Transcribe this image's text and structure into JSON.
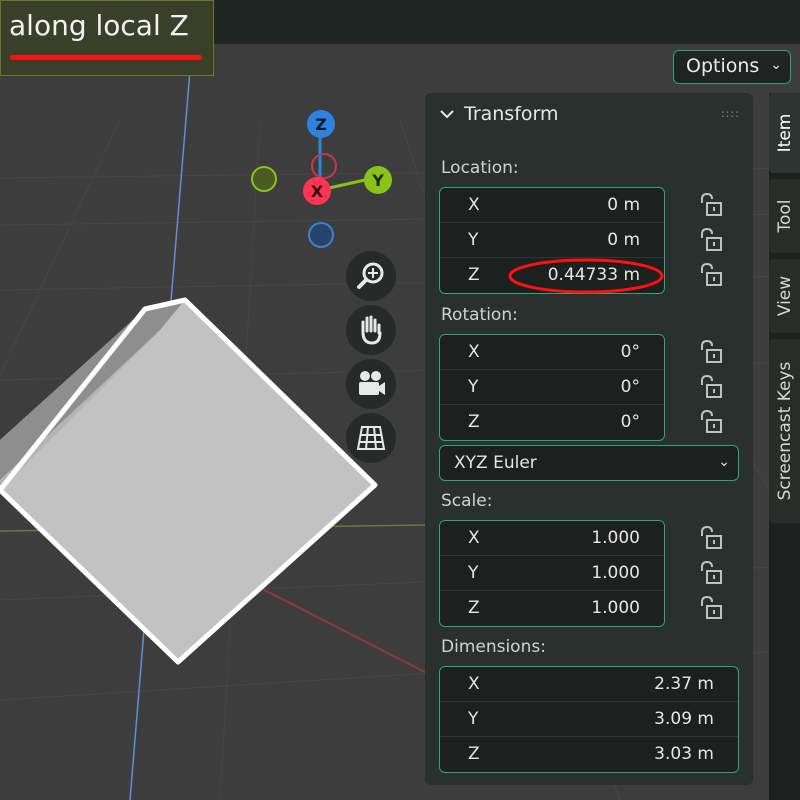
{
  "caption": {
    "text": "along local Z"
  },
  "options": {
    "label": "Options"
  },
  "gizmo": {
    "z": "Z",
    "x": "X",
    "y": "Y"
  },
  "panel": {
    "title": "Transform",
    "location": {
      "label": "Location:",
      "rows": [
        {
          "axis": "X",
          "value": "0 m"
        },
        {
          "axis": "Y",
          "value": "0 m"
        },
        {
          "axis": "Z",
          "value": "0.44733 m"
        }
      ]
    },
    "rotation": {
      "label": "Rotation:",
      "rows": [
        {
          "axis": "X",
          "value": "0°"
        },
        {
          "axis": "Y",
          "value": "0°"
        },
        {
          "axis": "Z",
          "value": "0°"
        }
      ]
    },
    "rotation_mode": "XYZ Euler",
    "scale": {
      "label": "Scale:",
      "rows": [
        {
          "axis": "X",
          "value": "1.000"
        },
        {
          "axis": "Y",
          "value": "1.000"
        },
        {
          "axis": "Z",
          "value": "1.000"
        }
      ]
    },
    "dimensions": {
      "label": "Dimensions:",
      "rows": [
        {
          "axis": "X",
          "value": "2.37 m"
        },
        {
          "axis": "Y",
          "value": "3.09 m"
        },
        {
          "axis": "Z",
          "value": "3.03 m"
        }
      ]
    }
  },
  "tabs": {
    "item": "Item",
    "tool": "Tool",
    "view": "View",
    "screencast": "Screencast Keys"
  },
  "colors": {
    "accent": "#27a585",
    "highlight": "#ff1010",
    "x_axis": "#ff3352",
    "y_axis": "#8bc21a",
    "z_axis": "#2f83e0"
  }
}
